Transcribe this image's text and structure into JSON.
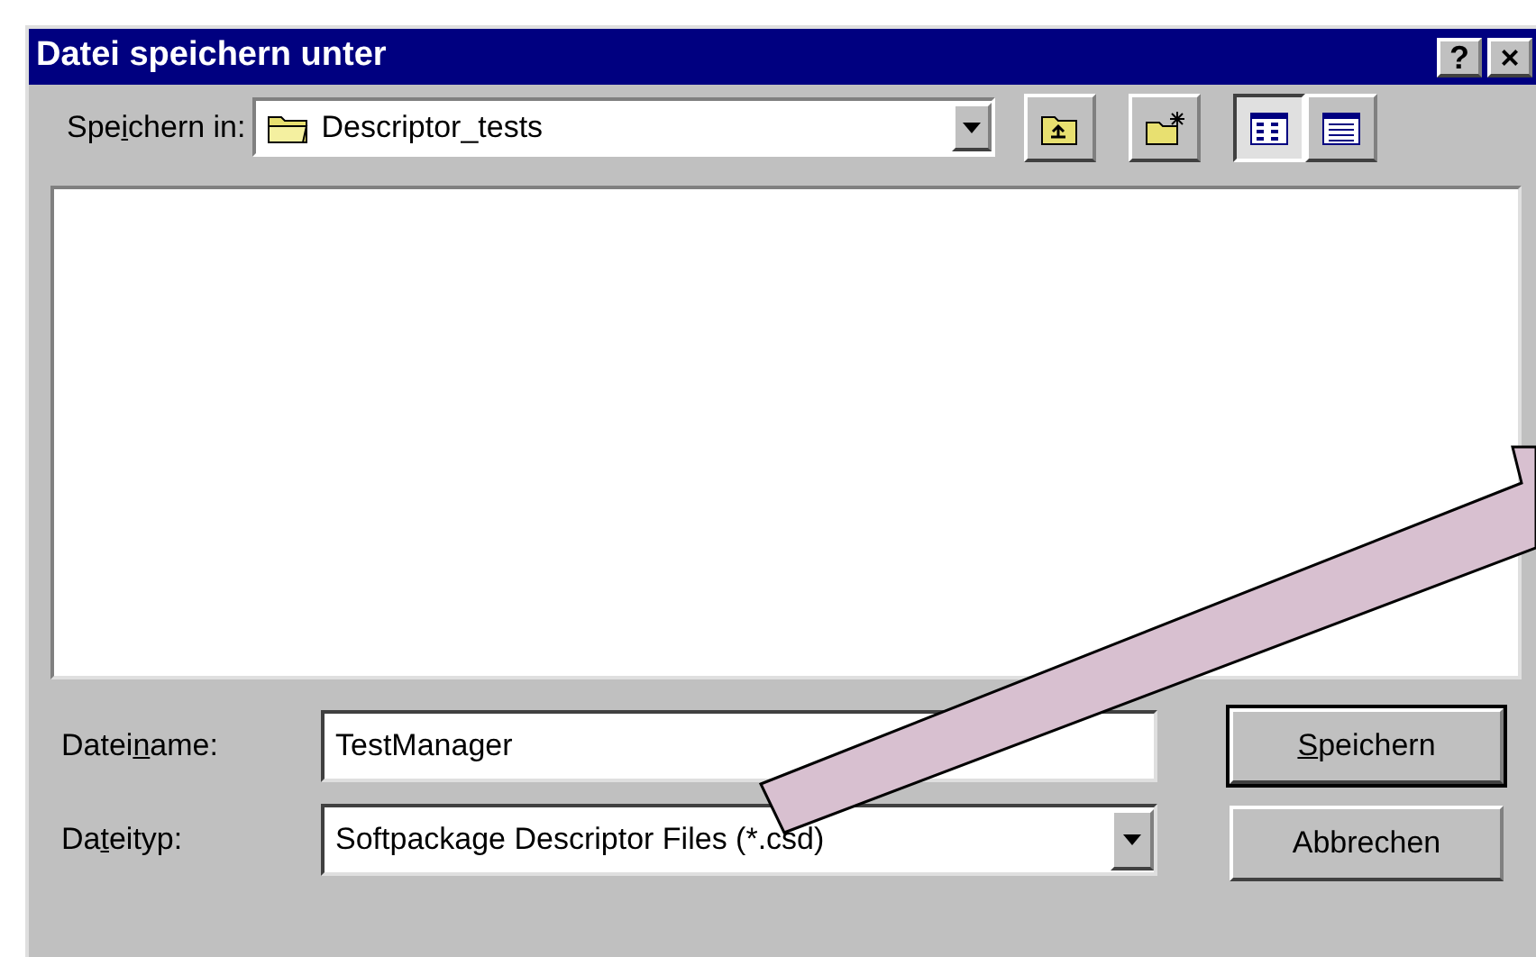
{
  "window": {
    "title": "Datei speichern unter"
  },
  "title_buttons": [
    {
      "label": "?"
    },
    {
      "label": "×"
    }
  ],
  "save_in": {
    "label": {
      "before": "Spe",
      "key": "i",
      "after": "chern in:"
    },
    "value": "Descriptor_tests"
  },
  "toolbar": [
    {
      "kind": "up-folder",
      "selected": false
    },
    {
      "kind": "new-folder",
      "selected": false
    },
    {
      "kind": "list-view",
      "selected": true
    },
    {
      "kind": "details-view",
      "selected": false
    }
  ],
  "file_name": {
    "label": {
      "before": "Datei",
      "key": "n",
      "after": "ame:"
    },
    "value": "TestManager"
  },
  "file_type": {
    "label": {
      "before": "Da",
      "key": "t",
      "after": "eityp:"
    },
    "value": "Softpackage Descriptor Files (*.csd)"
  },
  "buttons": [
    {
      "label": {
        "key": "S",
        "after": "peichern"
      },
      "default": true
    },
    {
      "label": {
        "after": "Abbrechen"
      },
      "default": false
    }
  ]
}
